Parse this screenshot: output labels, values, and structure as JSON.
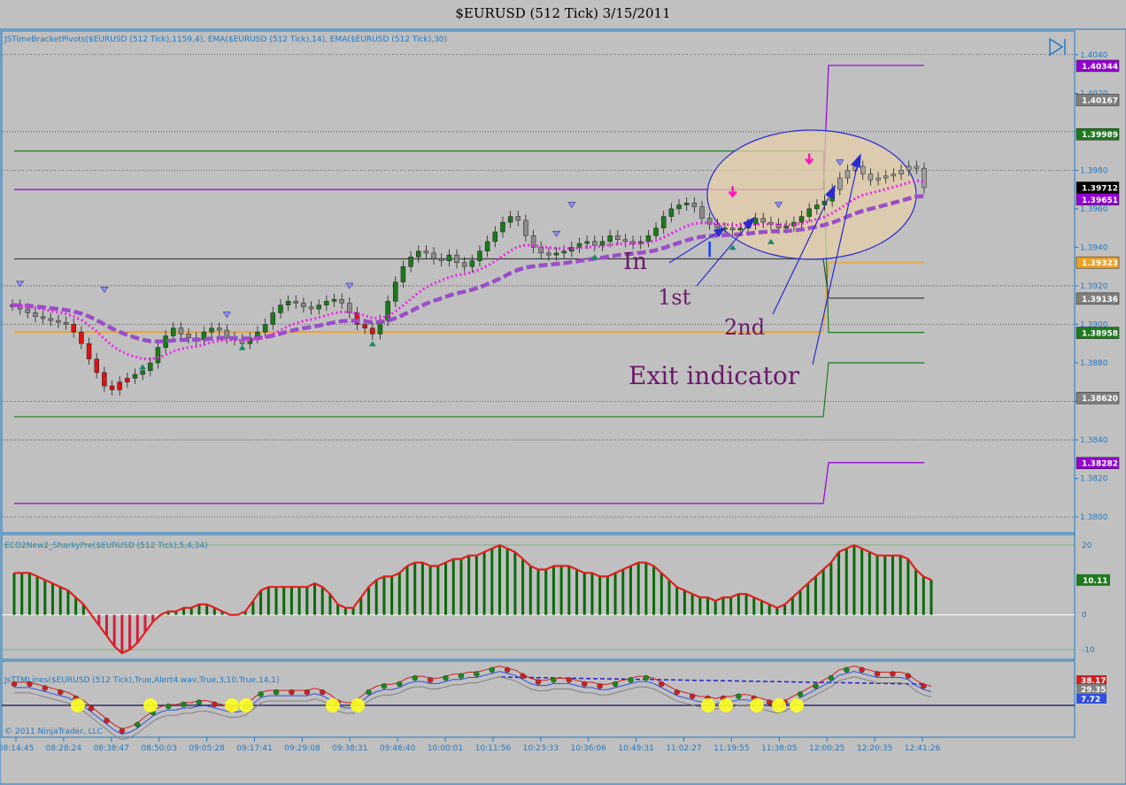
{
  "header": {
    "title": "$EURUSD (512 Tick)  3/15/2011"
  },
  "panels": {
    "price_label": "JSTimeBracketPivots($EURUSD (512 Tick),1159,4), EMA($EURUSD (512 Tick),14), EMA($EURUSD (512 Tick),30)",
    "osc_label": "ECO2New2_SharkyPre($EURUSD (512 Tick),5,4,34)",
    "lines_label": "JsTTMLines($EURUSD (512 Tick),True,Alert4.wav,True,3,10,True,14,1)",
    "copyright": "© 2011 NinjaTrader, LLC"
  },
  "annotations": {
    "in": "In",
    "first": "1st",
    "second": "2nd",
    "exit": "Exit indicator"
  },
  "colors": {
    "background": "#c0c0c0",
    "up_candle": "#1a7a1a",
    "down_candle": "#e01010",
    "neutral_candle": "#8a8a8a",
    "ema14": "#ee22ee",
    "ema30": "#9a4ec8",
    "pivot_purple": "#9400d3",
    "pivot_green": "#1e7a1e",
    "pivot_orange": "#f0a020",
    "axis_text": "#1e7ac8",
    "ellipse_fill": "#e6cfa8",
    "ellipse_stroke": "#2a2ad0"
  },
  "chart_data": [
    {
      "type": "candlestick",
      "name": "price",
      "ylim": [
        1.3795,
        1.405
      ],
      "y_ticks": [
        "1.4040",
        "1.4020",
        "1.4000",
        "1.3980",
        "1.3960",
        "1.3940",
        "1.3920",
        "1.3900",
        "1.3880",
        "1.3860",
        "1.3840",
        "1.3820",
        "1.3800"
      ],
      "x_ticks": [
        "08:14:45",
        "08:28:24",
        "08:38:47",
        "08:50:03",
        "09:05:28",
        "09:17:41",
        "09:29:08",
        "09:38:31",
        "09:46:40",
        "10:00:01",
        "10:11:56",
        "10:23:33",
        "10:36:06",
        "10:49:31",
        "11:02:27",
        "11:19:55",
        "11:38:05",
        "12:00:25",
        "12:20:35",
        "12:41:26"
      ],
      "closes": [
        1.391,
        1.3908,
        1.3906,
        1.3904,
        1.3903,
        1.3902,
        1.3901,
        1.39,
        1.3896,
        1.389,
        1.3882,
        1.3875,
        1.3868,
        1.3866,
        1.387,
        1.3872,
        1.3874,
        1.3876,
        1.388,
        1.3888,
        1.3894,
        1.3898,
        1.3895,
        1.3893,
        1.3892,
        1.3896,
        1.3898,
        1.3897,
        1.3893,
        1.3892,
        1.389,
        1.3893,
        1.3896,
        1.39,
        1.3906,
        1.391,
        1.3912,
        1.3911,
        1.3909,
        1.3908,
        1.391,
        1.3912,
        1.3913,
        1.3911,
        1.3906,
        1.39,
        1.3898,
        1.3895,
        1.3902,
        1.3912,
        1.3922,
        1.393,
        1.3935,
        1.3938,
        1.3937,
        1.3934,
        1.3933,
        1.3936,
        1.3932,
        1.393,
        1.3933,
        1.3938,
        1.3943,
        1.3948,
        1.3953,
        1.3956,
        1.3954,
        1.3946,
        1.394,
        1.3937,
        1.3936,
        1.3937,
        1.3938,
        1.394,
        1.3942,
        1.3943,
        1.3941,
        1.3943,
        1.3946,
        1.3944,
        1.3943,
        1.3942,
        1.3943,
        1.3946,
        1.395,
        1.3956,
        1.396,
        1.3962,
        1.3963,
        1.3961,
        1.3955,
        1.3952,
        1.395,
        1.395,
        1.3949,
        1.395,
        1.3952,
        1.3955,
        1.3953,
        1.3952,
        1.395,
        1.3951,
        1.3953,
        1.3956,
        1.396,
        1.3962,
        1.3964,
        1.397,
        1.3976,
        1.398,
        1.3982,
        1.3978,
        1.3975,
        1.3976,
        1.3977,
        1.3978,
        1.398,
        1.3982,
        1.3981,
        1.3971
      ],
      "ema14_last": 1.3971,
      "ema30_last": 1.3965,
      "pivot_levels": [
        "1.40344",
        "1.40167",
        "1.39989",
        "1.39712",
        "1.39651",
        "1.39323",
        "1.39136",
        "1.38958",
        "1.38620",
        "1.38282"
      ],
      "pivot_badge_colors": [
        "#9400d3",
        "#808080",
        "#1e7a1e",
        "#000000",
        "#9400d3",
        "#f0a020",
        "#808080",
        "#1e7a1e",
        "#808080",
        "#9400d3"
      ]
    },
    {
      "type": "bar",
      "name": "ECO2New2_SharkyPre",
      "ylim": [
        -12,
        22
      ],
      "y_ticks": [
        "20",
        "10",
        "0",
        "-10"
      ],
      "last_value": "10.11",
      "values": [
        12,
        12,
        12,
        11,
        10,
        9,
        8,
        7,
        5,
        3,
        0,
        -3,
        -6,
        -9,
        -11,
        -10,
        -8,
        -5,
        -2,
        0,
        1,
        1,
        2,
        2,
        3,
        3,
        2,
        1,
        0,
        0,
        1,
        4,
        7,
        8,
        8,
        8,
        8,
        8,
        8,
        9,
        8,
        6,
        3,
        2,
        2,
        5,
        8,
        10,
        11,
        11,
        12,
        14,
        15,
        15,
        14,
        14,
        15,
        16,
        16,
        17,
        17,
        18,
        19,
        20,
        19,
        18,
        16,
        14,
        13,
        13,
        14,
        14,
        14,
        13,
        12,
        12,
        11,
        11,
        12,
        13,
        14,
        15,
        15,
        14,
        12,
        10,
        8,
        7,
        6,
        5,
        5,
        4,
        5,
        5,
        6,
        6,
        5,
        4,
        3,
        2,
        3,
        5,
        7,
        9,
        11,
        13,
        15,
        18,
        19,
        20,
        19,
        18,
        17,
        17,
        17,
        17,
        16,
        13,
        11,
        10
      ]
    },
    {
      "type": "line",
      "name": "JsTTMLines",
      "y_ticks": [
        "29.35",
        "7.72"
      ],
      "top_value": "38.17"
    }
  ]
}
